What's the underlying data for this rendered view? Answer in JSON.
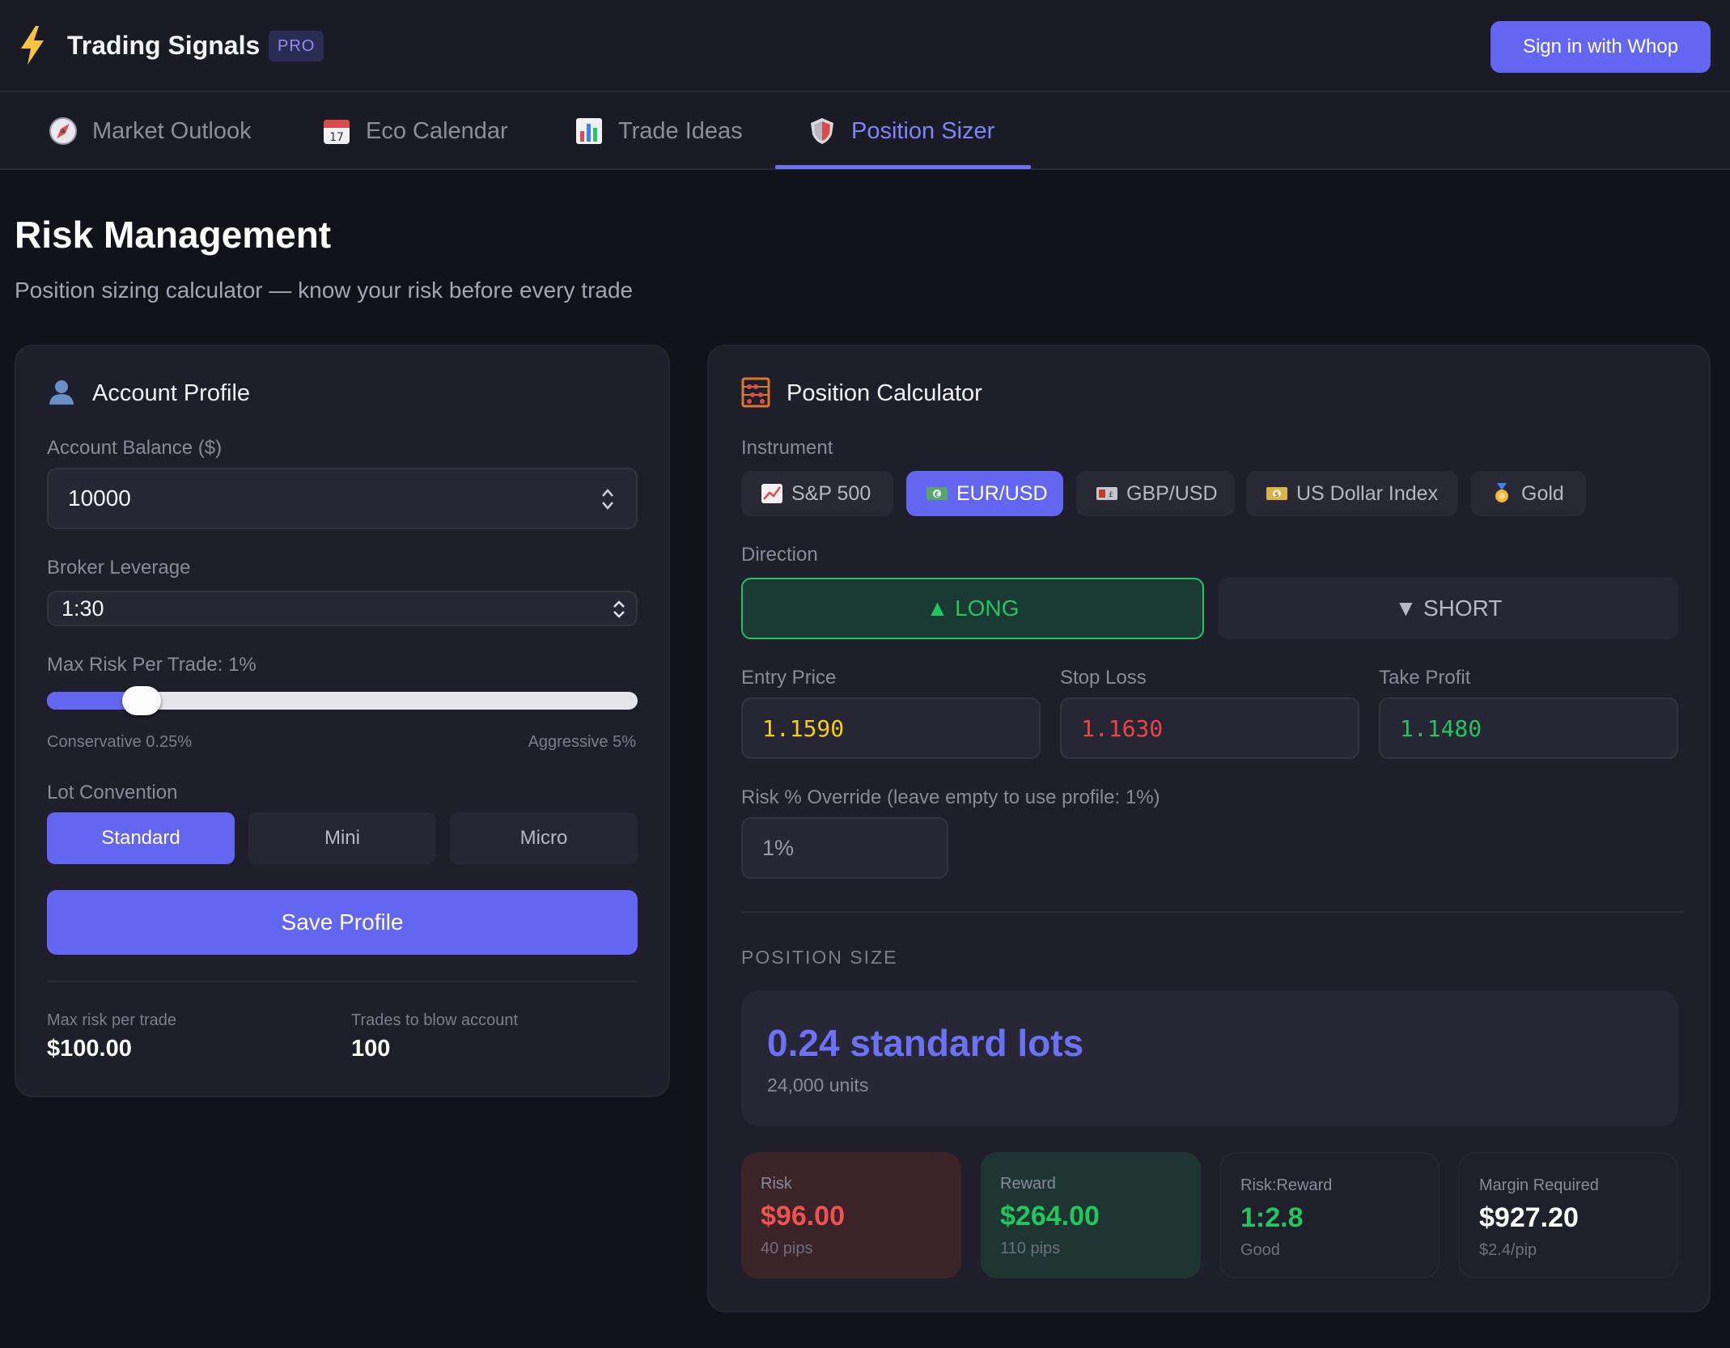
{
  "header": {
    "app_title": "Trading Signals",
    "badge": "PRO",
    "signin_label": "Sign in with Whop",
    "logo_icon": "lightning-bolt-icon"
  },
  "tabs": [
    {
      "label": "Market Outlook",
      "icon": "compass-icon",
      "active": false
    },
    {
      "label": "Eco Calendar",
      "icon": "calendar-icon",
      "active": false
    },
    {
      "label": "Trade Ideas",
      "icon": "bar-chart-icon",
      "active": false
    },
    {
      "label": "Position Sizer",
      "icon": "shield-icon",
      "active": true
    }
  ],
  "page": {
    "title": "Risk Management",
    "subtitle": "Position sizing calculator — know your risk before every trade"
  },
  "account_profile": {
    "title": "Account Profile",
    "icon": "user-icon",
    "balance_label": "Account Balance ($)",
    "balance_value": "10000",
    "leverage_label": "Broker Leverage",
    "leverage_value": "1:30",
    "risk_label": "Max Risk Per Trade: 1%",
    "risk_slider_fraction": 0.16,
    "risk_min_label": "Conservative 0.25%",
    "risk_max_label": "Aggressive 5%",
    "lot_label": "Lot Convention",
    "lot_options": [
      "Standard",
      "Mini",
      "Micro"
    ],
    "lot_selected": "Standard",
    "save_label": "Save Profile",
    "max_risk_label": "Max risk per trade",
    "max_risk_value": "$100.00",
    "trades_label": "Trades to blow account",
    "trades_value": "100"
  },
  "calculator": {
    "title": "Position Calculator",
    "icon": "abacus-icon",
    "instrument_label": "Instrument",
    "instruments": [
      {
        "label": "S&P 500",
        "icon": "chart-up-icon",
        "active": false
      },
      {
        "label": "EUR/USD",
        "icon": "euro-banknote-icon",
        "active": true
      },
      {
        "label": "GBP/USD",
        "icon": "pound-banknote-icon",
        "active": false
      },
      {
        "label": "US Dollar Index",
        "icon": "dollar-banknote-icon",
        "active": false
      },
      {
        "label": "Gold",
        "icon": "medal-icon",
        "active": false
      }
    ],
    "direction_label": "Direction",
    "long_label": "▲ LONG",
    "short_label": "▼ SHORT",
    "direction_selected": "LONG",
    "entry_label": "Entry Price",
    "entry_value": "1.1590",
    "stop_label": "Stop Loss",
    "stop_value": "1.1630",
    "take_label": "Take Profit",
    "take_value": "1.1480",
    "override_label": "Risk % Override (leave empty to use profile: 1%)",
    "override_placeholder": "1%",
    "position_heading": "POSITION SIZE",
    "lots_text": "0.24 standard lots",
    "units_text": "24,000 units",
    "stats": [
      {
        "label": "Risk",
        "value": "$96.00",
        "sub": "40 pips",
        "color": "#ef5350"
      },
      {
        "label": "Reward",
        "value": "$264.00",
        "sub": "110 pips",
        "color": "#22c55e"
      },
      {
        "label": "Risk:Reward",
        "value": "1:2.8",
        "sub": "Good",
        "color": "#22c55e"
      },
      {
        "label": "Margin Required",
        "value": "$927.20",
        "sub": "$2.4/pip",
        "color": "#ffffff"
      }
    ]
  },
  "colors": {
    "accent": "#6366f1",
    "entry": "#facc15",
    "stop": "#ef4444",
    "take": "#22c55e",
    "background": "#12121a",
    "card": "#1f1f2b"
  }
}
